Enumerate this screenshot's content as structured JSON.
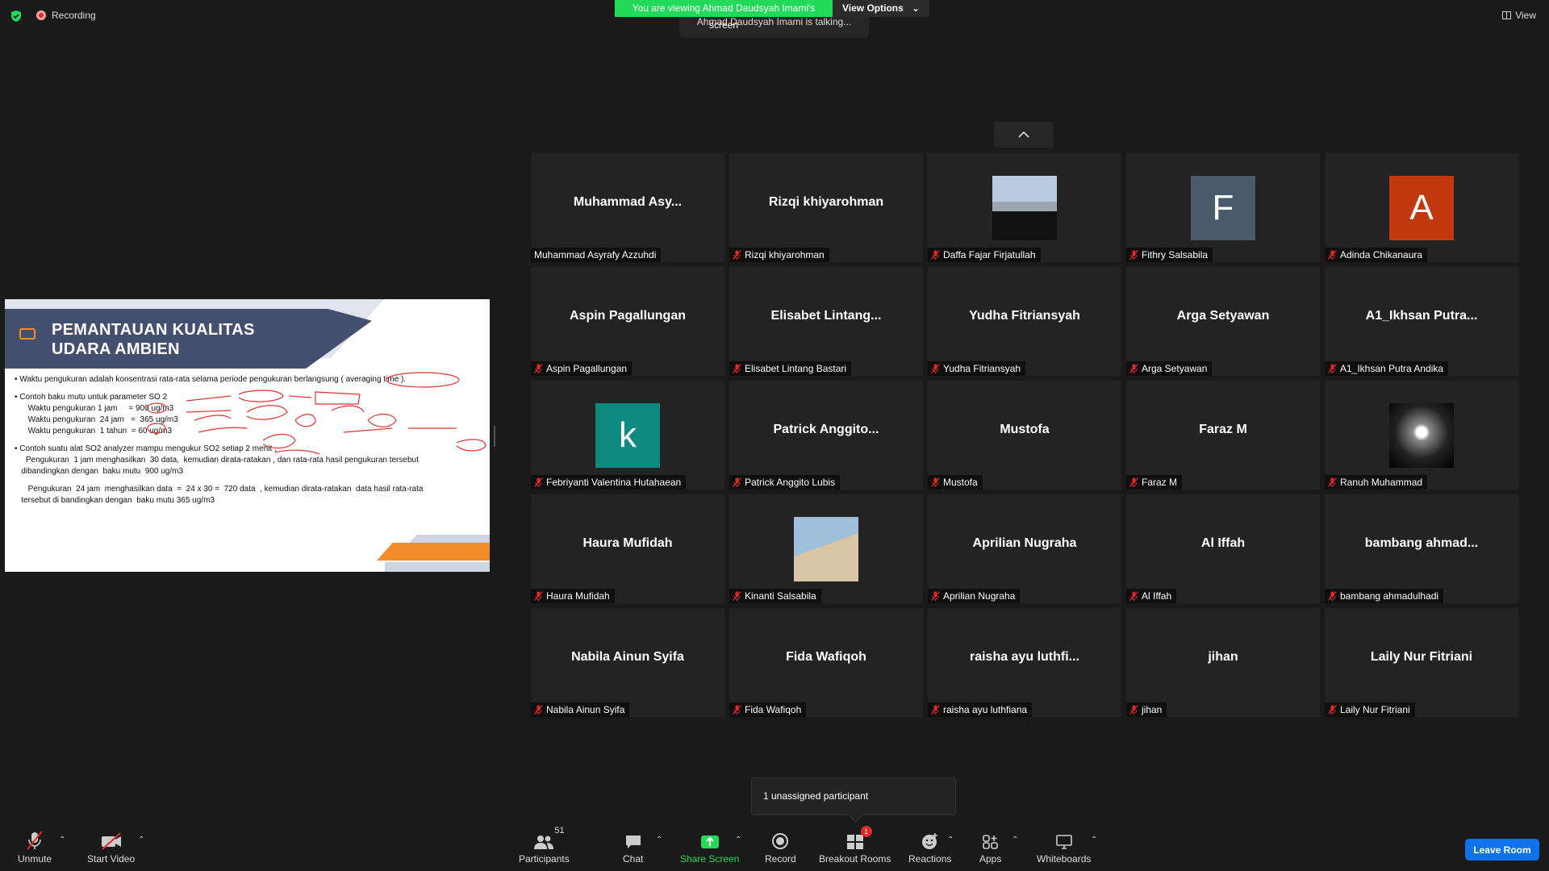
{
  "top": {
    "recording_label": "Recording",
    "viewing_banner": "You are viewing Ahmad Daudsyah Imami's screen",
    "view_options_label": "View Options",
    "talking": "Ahmad Daudsyah Imami is talking...",
    "view_label": "View"
  },
  "slide": {
    "title_line1": "PEMANTAUAN KUALITAS",
    "title_line2": "UDARA AMBIEN",
    "lines": [
      "•  Waktu pengukuran adalah   konsentrasi  rata-rata selama periode  pengukuran  berlangsung  ( averaging time ).",
      "•  Contoh    baku mutu  untuk  parameter SO 2",
      "      Waktu pengukuran 1 jam     = 900 ug/m3",
      "      Waktu pengukuran  24 jam   =  365 ug/m3",
      "      Waktu pengukuran  1 tahun  = 60 ug/m3",
      "•  Contoh  suatu alat SO2 analyzer   mampu mengukur SO2 setiap 2 menit ,",
      "     Pengukuran  1 jam menghasilkan  30 data,  kemudian dirata-ratakan , dan rata-rata hasil pengukuran tersebut",
      "   dibandingkan dengan  baku mutu  900 ug/m3",
      "      Pengukuran  24 jam  menghasilkan data  =  24 x 30 =  720 data  , kemudian dirata-ratakan  data hasil rata-rata",
      "   tersebut di bandingkan dengan  baku mutu 365 ug/m3"
    ]
  },
  "participants": [
    {
      "center": "Muhammad  Asy...",
      "label": "Muhammad Asyrafy Azzuhdi",
      "muted": false,
      "avatar": null
    },
    {
      "center": "Rizqi khiyarohman",
      "label": "Rizqi khiyarohman",
      "muted": true,
      "avatar": null
    },
    {
      "center": "",
      "label": "Daffa Fajar Firjatullah",
      "muted": true,
      "avatar": "kaaba"
    },
    {
      "center": "",
      "label": "Fithry Salsabila",
      "muted": true,
      "avatar": "letter",
      "letter": "F",
      "color": "#4a5a6a"
    },
    {
      "center": "",
      "label": "Adinda Chikanaura",
      "muted": true,
      "avatar": "letter",
      "letter": "A",
      "color": "#c0390f"
    },
    {
      "center": "Aspin Pagallungan",
      "label": "Aspin Pagallungan",
      "muted": true,
      "avatar": null
    },
    {
      "center": "Elisabet  Lintang...",
      "label": "Elisabet Lintang Bastari",
      "muted": true,
      "avatar": null
    },
    {
      "center": "Yudha Fitriansyah",
      "label": "Yudha Fitriansyah",
      "muted": true,
      "avatar": null
    },
    {
      "center": "Arga Setyawan",
      "label": "Arga Setyawan",
      "muted": true,
      "avatar": null
    },
    {
      "center": "A1_Ikhsan  Putra...",
      "label": "A1_Ikhsan Putra Andika",
      "muted": true,
      "avatar": null
    },
    {
      "center": "",
      "label": "Febriyanti Valentina Hutahaean",
      "muted": true,
      "avatar": "letter",
      "letter": "k",
      "color": "#0e8a7e"
    },
    {
      "center": "Patrick  Anggito...",
      "label": "Patrick Anggito Lubis",
      "muted": true,
      "avatar": null
    },
    {
      "center": "Mustofa",
      "label": "Mustofa",
      "muted": true,
      "avatar": null
    },
    {
      "center": "Faraz M",
      "label": "Faraz M",
      "muted": true,
      "avatar": null
    },
    {
      "center": "",
      "label": "Ranuh Muhammad",
      "muted": true,
      "avatar": "chess"
    },
    {
      "center": "Haura Mufidah",
      "label": "Haura Mufidah",
      "muted": true,
      "avatar": null
    },
    {
      "center": "",
      "label": "Kinanti Salsabila",
      "muted": true,
      "avatar": "portrait"
    },
    {
      "center": "Aprilian Nugraha",
      "label": "Aprilian Nugraha",
      "muted": true,
      "avatar": null
    },
    {
      "center": "Al Iffah",
      "label": "Al Iffah",
      "muted": true,
      "avatar": null
    },
    {
      "center": "bambang  ahmad...",
      "label": "bambang ahmadulhadi",
      "muted": true,
      "avatar": null
    },
    {
      "center": "Nabila Ainun Syifa",
      "label": "Nabila Ainun Syifa",
      "muted": true,
      "avatar": null
    },
    {
      "center": "Fida Wafiqoh",
      "label": "Fida Wafiqoh",
      "muted": true,
      "avatar": null
    },
    {
      "center": "raisha  ayu  luthfi...",
      "label": "raisha ayu luthfiana",
      "muted": true,
      "avatar": null
    },
    {
      "center": "jihan",
      "label": "jihan",
      "muted": true,
      "avatar": null
    },
    {
      "center": "Laily Nur Fitriani",
      "label": "Laily Nur Fitriani",
      "muted": true,
      "avatar": null
    }
  ],
  "popup": {
    "text": "1 unassigned participant"
  },
  "toolbar": {
    "unmute": "Unmute",
    "start_video": "Start Video",
    "participants": "Participants",
    "participants_count": "51",
    "chat": "Chat",
    "share_screen": "Share Screen",
    "record": "Record",
    "breakout_rooms": "Breakout Rooms",
    "breakout_badge": "1",
    "reactions": "Reactions",
    "apps": "Apps",
    "whiteboards": "Whiteboards",
    "leave": "Leave Room",
    "share_color": "#23d959",
    "leave_color": "#0e72ed"
  }
}
